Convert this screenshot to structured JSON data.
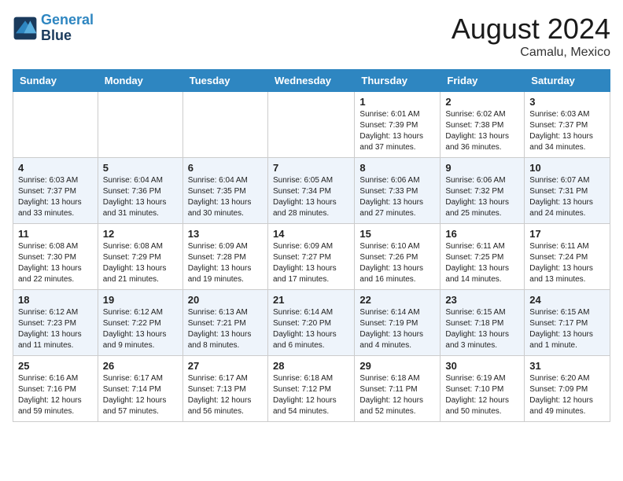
{
  "header": {
    "logo_line1": "General",
    "logo_line2": "Blue",
    "month_year": "August 2024",
    "location": "Camalu, Mexico"
  },
  "days_of_week": [
    "Sunday",
    "Monday",
    "Tuesday",
    "Wednesday",
    "Thursday",
    "Friday",
    "Saturday"
  ],
  "weeks": [
    [
      {
        "day": "",
        "info": ""
      },
      {
        "day": "",
        "info": ""
      },
      {
        "day": "",
        "info": ""
      },
      {
        "day": "",
        "info": ""
      },
      {
        "day": "1",
        "info": "Sunrise: 6:01 AM\nSunset: 7:39 PM\nDaylight: 13 hours\nand 37 minutes."
      },
      {
        "day": "2",
        "info": "Sunrise: 6:02 AM\nSunset: 7:38 PM\nDaylight: 13 hours\nand 36 minutes."
      },
      {
        "day": "3",
        "info": "Sunrise: 6:03 AM\nSunset: 7:37 PM\nDaylight: 13 hours\nand 34 minutes."
      }
    ],
    [
      {
        "day": "4",
        "info": "Sunrise: 6:03 AM\nSunset: 7:37 PM\nDaylight: 13 hours\nand 33 minutes."
      },
      {
        "day": "5",
        "info": "Sunrise: 6:04 AM\nSunset: 7:36 PM\nDaylight: 13 hours\nand 31 minutes."
      },
      {
        "day": "6",
        "info": "Sunrise: 6:04 AM\nSunset: 7:35 PM\nDaylight: 13 hours\nand 30 minutes."
      },
      {
        "day": "7",
        "info": "Sunrise: 6:05 AM\nSunset: 7:34 PM\nDaylight: 13 hours\nand 28 minutes."
      },
      {
        "day": "8",
        "info": "Sunrise: 6:06 AM\nSunset: 7:33 PM\nDaylight: 13 hours\nand 27 minutes."
      },
      {
        "day": "9",
        "info": "Sunrise: 6:06 AM\nSunset: 7:32 PM\nDaylight: 13 hours\nand 25 minutes."
      },
      {
        "day": "10",
        "info": "Sunrise: 6:07 AM\nSunset: 7:31 PM\nDaylight: 13 hours\nand 24 minutes."
      }
    ],
    [
      {
        "day": "11",
        "info": "Sunrise: 6:08 AM\nSunset: 7:30 PM\nDaylight: 13 hours\nand 22 minutes."
      },
      {
        "day": "12",
        "info": "Sunrise: 6:08 AM\nSunset: 7:29 PM\nDaylight: 13 hours\nand 21 minutes."
      },
      {
        "day": "13",
        "info": "Sunrise: 6:09 AM\nSunset: 7:28 PM\nDaylight: 13 hours\nand 19 minutes."
      },
      {
        "day": "14",
        "info": "Sunrise: 6:09 AM\nSunset: 7:27 PM\nDaylight: 13 hours\nand 17 minutes."
      },
      {
        "day": "15",
        "info": "Sunrise: 6:10 AM\nSunset: 7:26 PM\nDaylight: 13 hours\nand 16 minutes."
      },
      {
        "day": "16",
        "info": "Sunrise: 6:11 AM\nSunset: 7:25 PM\nDaylight: 13 hours\nand 14 minutes."
      },
      {
        "day": "17",
        "info": "Sunrise: 6:11 AM\nSunset: 7:24 PM\nDaylight: 13 hours\nand 13 minutes."
      }
    ],
    [
      {
        "day": "18",
        "info": "Sunrise: 6:12 AM\nSunset: 7:23 PM\nDaylight: 13 hours\nand 11 minutes."
      },
      {
        "day": "19",
        "info": "Sunrise: 6:12 AM\nSunset: 7:22 PM\nDaylight: 13 hours\nand 9 minutes."
      },
      {
        "day": "20",
        "info": "Sunrise: 6:13 AM\nSunset: 7:21 PM\nDaylight: 13 hours\nand 8 minutes."
      },
      {
        "day": "21",
        "info": "Sunrise: 6:14 AM\nSunset: 7:20 PM\nDaylight: 13 hours\nand 6 minutes."
      },
      {
        "day": "22",
        "info": "Sunrise: 6:14 AM\nSunset: 7:19 PM\nDaylight: 13 hours\nand 4 minutes."
      },
      {
        "day": "23",
        "info": "Sunrise: 6:15 AM\nSunset: 7:18 PM\nDaylight: 13 hours\nand 3 minutes."
      },
      {
        "day": "24",
        "info": "Sunrise: 6:15 AM\nSunset: 7:17 PM\nDaylight: 13 hours\nand 1 minute."
      }
    ],
    [
      {
        "day": "25",
        "info": "Sunrise: 6:16 AM\nSunset: 7:16 PM\nDaylight: 12 hours\nand 59 minutes."
      },
      {
        "day": "26",
        "info": "Sunrise: 6:17 AM\nSunset: 7:14 PM\nDaylight: 12 hours\nand 57 minutes."
      },
      {
        "day": "27",
        "info": "Sunrise: 6:17 AM\nSunset: 7:13 PM\nDaylight: 12 hours\nand 56 minutes."
      },
      {
        "day": "28",
        "info": "Sunrise: 6:18 AM\nSunset: 7:12 PM\nDaylight: 12 hours\nand 54 minutes."
      },
      {
        "day": "29",
        "info": "Sunrise: 6:18 AM\nSunset: 7:11 PM\nDaylight: 12 hours\nand 52 minutes."
      },
      {
        "day": "30",
        "info": "Sunrise: 6:19 AM\nSunset: 7:10 PM\nDaylight: 12 hours\nand 50 minutes."
      },
      {
        "day": "31",
        "info": "Sunrise: 6:20 AM\nSunset: 7:09 PM\nDaylight: 12 hours\nand 49 minutes."
      }
    ]
  ]
}
